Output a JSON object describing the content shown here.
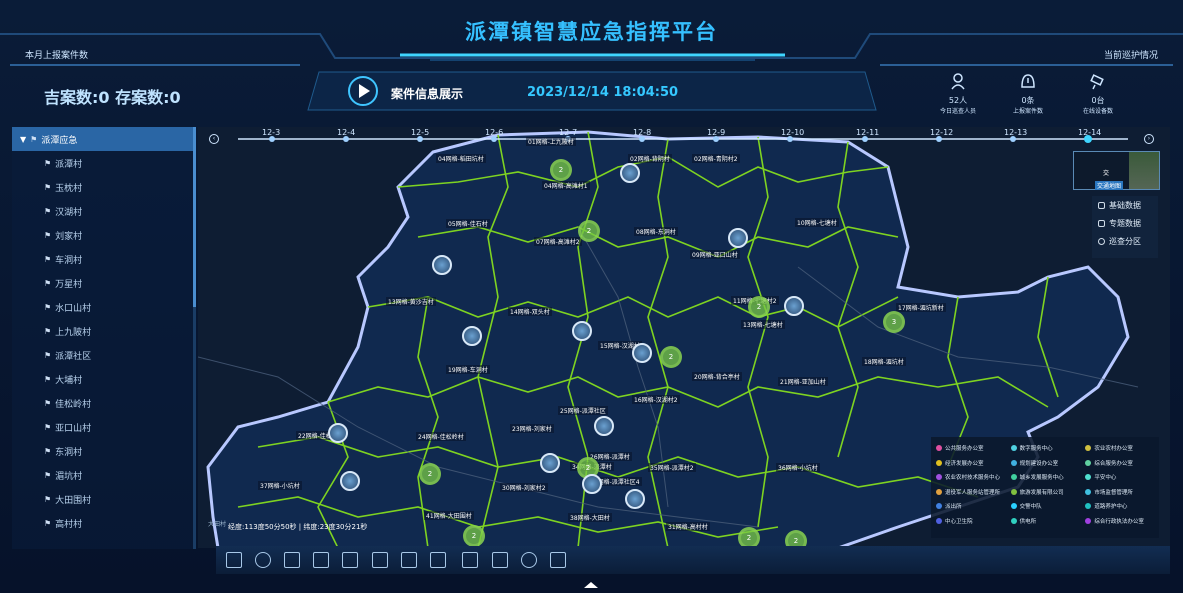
{
  "header": {
    "title": "派潭镇智慧应急指挥平台",
    "left_label": "本月上报案件数",
    "right_label": "当前巡护情况",
    "counts_text": "吉案数:0 存案数:0",
    "case_label": "案件信息展示",
    "datetime": "2023/12/14 18:04:50",
    "stats": [
      {
        "icon": "person-icon",
        "value": "52人",
        "label": "今日巡查人员"
      },
      {
        "icon": "alert-icon",
        "value": "0条",
        "label": "上报案件数"
      },
      {
        "icon": "camera-icon",
        "value": "0台",
        "label": "在线设备数"
      }
    ]
  },
  "sidebar": {
    "root": "派潭应急",
    "items": [
      "派潭村",
      "玉枕村",
      "汉湖村",
      "刘家村",
      "车洞村",
      "万星村",
      "水口山村",
      "上九陂村",
      "派潭社区",
      "大埔村",
      "佳松岭村",
      "亚口山村",
      "东洞村",
      "湄坑村",
      "大田围村",
      "高村村"
    ]
  },
  "timeline": {
    "dates": [
      "12-3",
      "12-4",
      "12-5",
      "12-6",
      "12-7",
      "12-8",
      "12-9",
      "12-10",
      "12-11",
      "12-12",
      "12-13",
      "12-14"
    ],
    "active": "12-14",
    "prev": "‹",
    "next": "›"
  },
  "map": {
    "grid_labels": [
      "01网格-上九陂村",
      "04网格-稻田坑村",
      "02网格-背阴村",
      "02网格-青阴村2",
      "04网格-高滩村1",
      "05网格-佳石村",
      "07网格-高滩村2",
      "08网格-东洞村",
      "09网格-亚口山村",
      "10网格-七塘村",
      "13网格-黄沙吉村",
      "14网格-双头村",
      "15网格-汉湖村",
      "11网格-七塘村2",
      "13网格-七塘村",
      "17网格-湄坑新村",
      "18网格-湄坑村",
      "19网格-车洞村",
      "16网格-汉湖村2",
      "20网格-背合亭村",
      "21网格-亚加山村",
      "22网格-佳松岭村",
      "24网格-佳松岭村",
      "23网格-刘家村",
      "25网格-派潭社区",
      "26网格-派潭村",
      "34网格-派潭村",
      "35网格-派潭村2",
      "36网格-小坑村",
      "37网格-小坑村",
      "30网格-刘家村2",
      "33网格-派潭社区4",
      "41网格-大田围村",
      "38网格-大田村",
      "31网格-高村村"
    ],
    "clusters": [
      "2",
      "2",
      "2",
      "3",
      "2",
      "2",
      "2",
      "2",
      "2",
      "2"
    ],
    "thumb_label1": "交",
    "thumb_label2": "交通地图",
    "layers": [
      "基础数据",
      "专题数据",
      "巡查分区"
    ],
    "coords": "经度:113度50分50秒 | 纬度:23度30分21秒",
    "scale": "大田村",
    "legend": [
      {
        "label": "公共服务办公室",
        "color": "#e04fa0"
      },
      {
        "label": "数字服务中心",
        "color": "#4fd0e0"
      },
      {
        "label": "农业农村办公室",
        "color": "#d0c040"
      },
      {
        "label": "经济发展办公室",
        "color": "#e0c020"
      },
      {
        "label": "规划建设办公室",
        "color": "#40b0e0"
      },
      {
        "label": "综合服务办公室",
        "color": "#60d0a0"
      },
      {
        "label": "农业农村技术服务中心",
        "color": "#a050e0"
      },
      {
        "label": "城乡发展服务中心",
        "color": "#40d0a0"
      },
      {
        "label": "平安中心",
        "color": "#50e0d0"
      },
      {
        "label": "退役军人服务站管理所",
        "color": "#e0a040"
      },
      {
        "label": "旅游发展有限公司",
        "color": "#80c040"
      },
      {
        "label": "市场监督管理所",
        "color": "#40c0e0"
      },
      {
        "label": "派出所",
        "color": "#4080e0"
      },
      {
        "label": "交警中队",
        "color": "#2ad0ff"
      },
      {
        "label": "道路养护中心",
        "color": "#20c0c0"
      },
      {
        "label": "中心卫生院",
        "color": "#5060e0"
      },
      {
        "label": "供电所",
        "color": "#30d0c0"
      },
      {
        "label": "综合行政执法办公室",
        "color": "#a040e0"
      }
    ]
  },
  "toolbar": {
    "tools": [
      "fullscreen-icon",
      "globe-icon",
      "grid-icon",
      "grid-alt-icon",
      "expand-icon",
      "prev-icon",
      "next-icon",
      "measure-icon",
      "chart-icon",
      "region-icon",
      "layers-icon",
      "refresh-icon"
    ]
  },
  "colors": {
    "title": "#35c0ff",
    "boundary": "#7ed321",
    "border": "#b8c8ff"
  }
}
